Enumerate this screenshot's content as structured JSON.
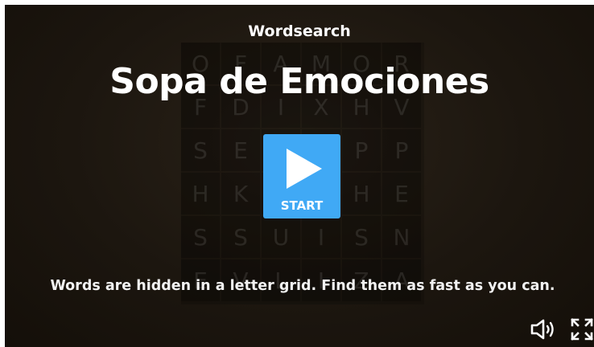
{
  "header": {
    "game_type": "Wordsearch",
    "title": "Sopa de Emociones"
  },
  "grid": {
    "rows": [
      [
        "O",
        "F",
        "A",
        "M",
        "O",
        "R"
      ],
      [
        "F",
        "D",
        "I",
        "X",
        "H",
        "V"
      ],
      [
        "S",
        "E",
        "",
        "",
        "P",
        "P"
      ],
      [
        "H",
        "K",
        "",
        "",
        "H",
        "E"
      ],
      [
        "S",
        "S",
        "U",
        "I",
        "S",
        "N"
      ],
      [
        "E",
        "V",
        "L",
        "I",
        "Z",
        "A"
      ]
    ]
  },
  "start": {
    "label": "START"
  },
  "description": "Words are hidden in a letter grid. Find them as fast as you can.",
  "controls": {
    "sound_icon": "speaker-icon",
    "fullscreen_icon": "fullscreen-icon"
  },
  "colors": {
    "start_button": "#40a9f5",
    "background": "#1c160f",
    "text": "#ffffff"
  }
}
